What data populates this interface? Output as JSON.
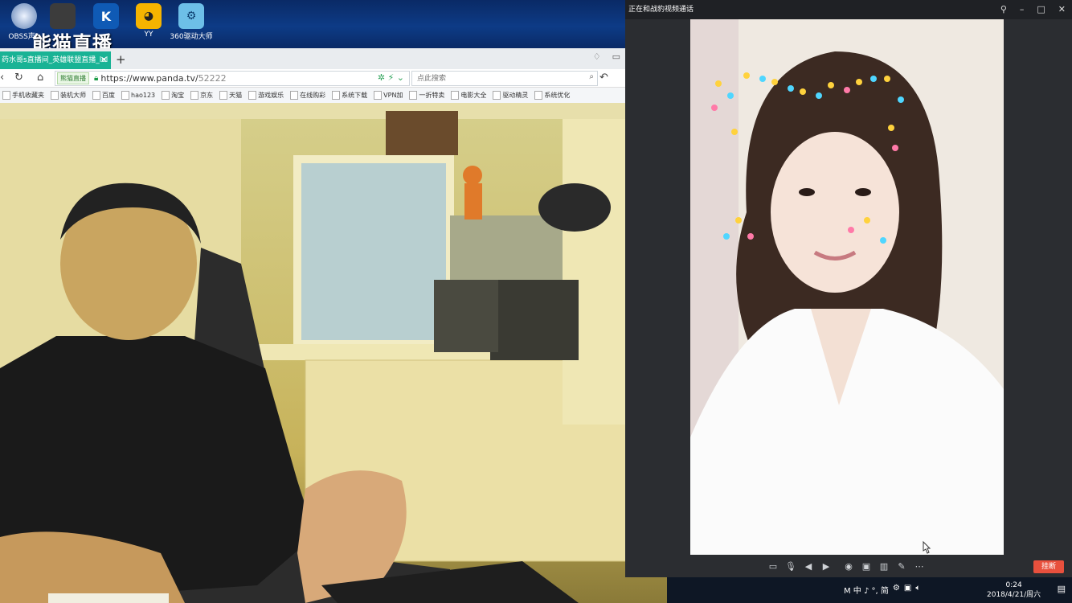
{
  "desktop": {
    "icons": [
      {
        "label": "OBSS声1"
      },
      {
        "label": ""
      },
      {
        "label": ""
      },
      {
        "label": "YY"
      },
      {
        "label": "360驱动大师"
      }
    ],
    "brand_overlay": "能猫直播"
  },
  "browser": {
    "tab_title": "药水哥s直播间_英雄联盟直播_lol",
    "new_tab_glyph": "+",
    "site_badge": "熊猫直播",
    "url_host": "https://www.panda.tv/",
    "url_path": "52222",
    "search_placeholder": "点此搜索",
    "bookmarks": [
      "手机收藏夹",
      "装机大师",
      "百度",
      "hao123",
      "淘宝",
      "京东",
      "天猫",
      "游戏娱乐",
      "在线购彩",
      "系统下载",
      "VPN加",
      "一折特卖",
      "电影大全",
      "驱动精灵",
      "系统优化"
    ]
  },
  "call_window": {
    "title": "正在和战豹视频通话",
    "hangup_label": "挂断",
    "toolbar_icons": [
      "chat-icon",
      "mic-icon",
      "speaker-icon",
      "camera-icon",
      "snapshot-icon",
      "record-icon",
      "layout-icon",
      "edit-icon",
      "more-icon"
    ]
  },
  "taskbar": {
    "tray_text": "M 中 ♪ °, 简",
    "time": "0:24",
    "date": "2018/4/21/周六"
  },
  "colors": {
    "tab_active": "#19b395",
    "hangup": "#e8503d",
    "desktop": "#0d3b86"
  }
}
